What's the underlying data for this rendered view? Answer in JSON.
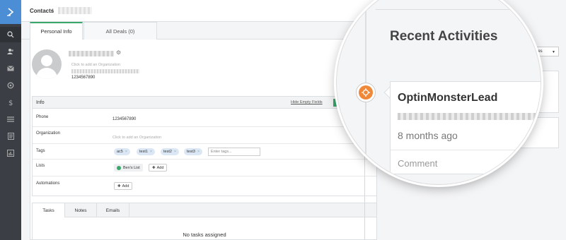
{
  "breadcrumb": {
    "root": "Contacts",
    "separator": "/"
  },
  "tabs": {
    "personal": "Personal Info",
    "deals": "All Deals (0)"
  },
  "contact": {
    "org_placeholder": "Click to add an Organization",
    "phone": "1234567890"
  },
  "info": {
    "title": "Info",
    "hide_empty": "Hide Empty Fields",
    "phone_label": "Phone",
    "phone_value": "1234567890",
    "org_label": "Organization",
    "org_placeholder": "Click to add an Organization",
    "tags_label": "Tags",
    "tags": [
      "ac5",
      "test1",
      "test2",
      "test3"
    ],
    "tags_placeholder": "Enter tags...",
    "lists_label": "Lists",
    "list_name": "Ben's List",
    "add_label": "Add",
    "automations_label": "Automations",
    "automations_add": "Add"
  },
  "tasks": {
    "tabs": [
      "Tasks",
      "Notes",
      "Emails"
    ],
    "empty": "No tasks assigned"
  },
  "activities": {
    "filter": "Activities",
    "heading": "Recent Activities",
    "item_title": "OptinMonsterLead",
    "item_time": "8 months ago",
    "item_comment": "Comment"
  },
  "icons": {
    "logo": "chevron-right-icon",
    "rail": [
      "search-icon",
      "contacts-icon",
      "mail-icon",
      "automation-icon",
      "dollar-icon",
      "list-icon",
      "forms-icon",
      "reports-icon"
    ]
  },
  "colors": {
    "accent_green": "#3aa86b",
    "brand_blue": "#4b8ed6",
    "activity_orange": "#f0883a",
    "sidebar": "#3b3f45"
  }
}
